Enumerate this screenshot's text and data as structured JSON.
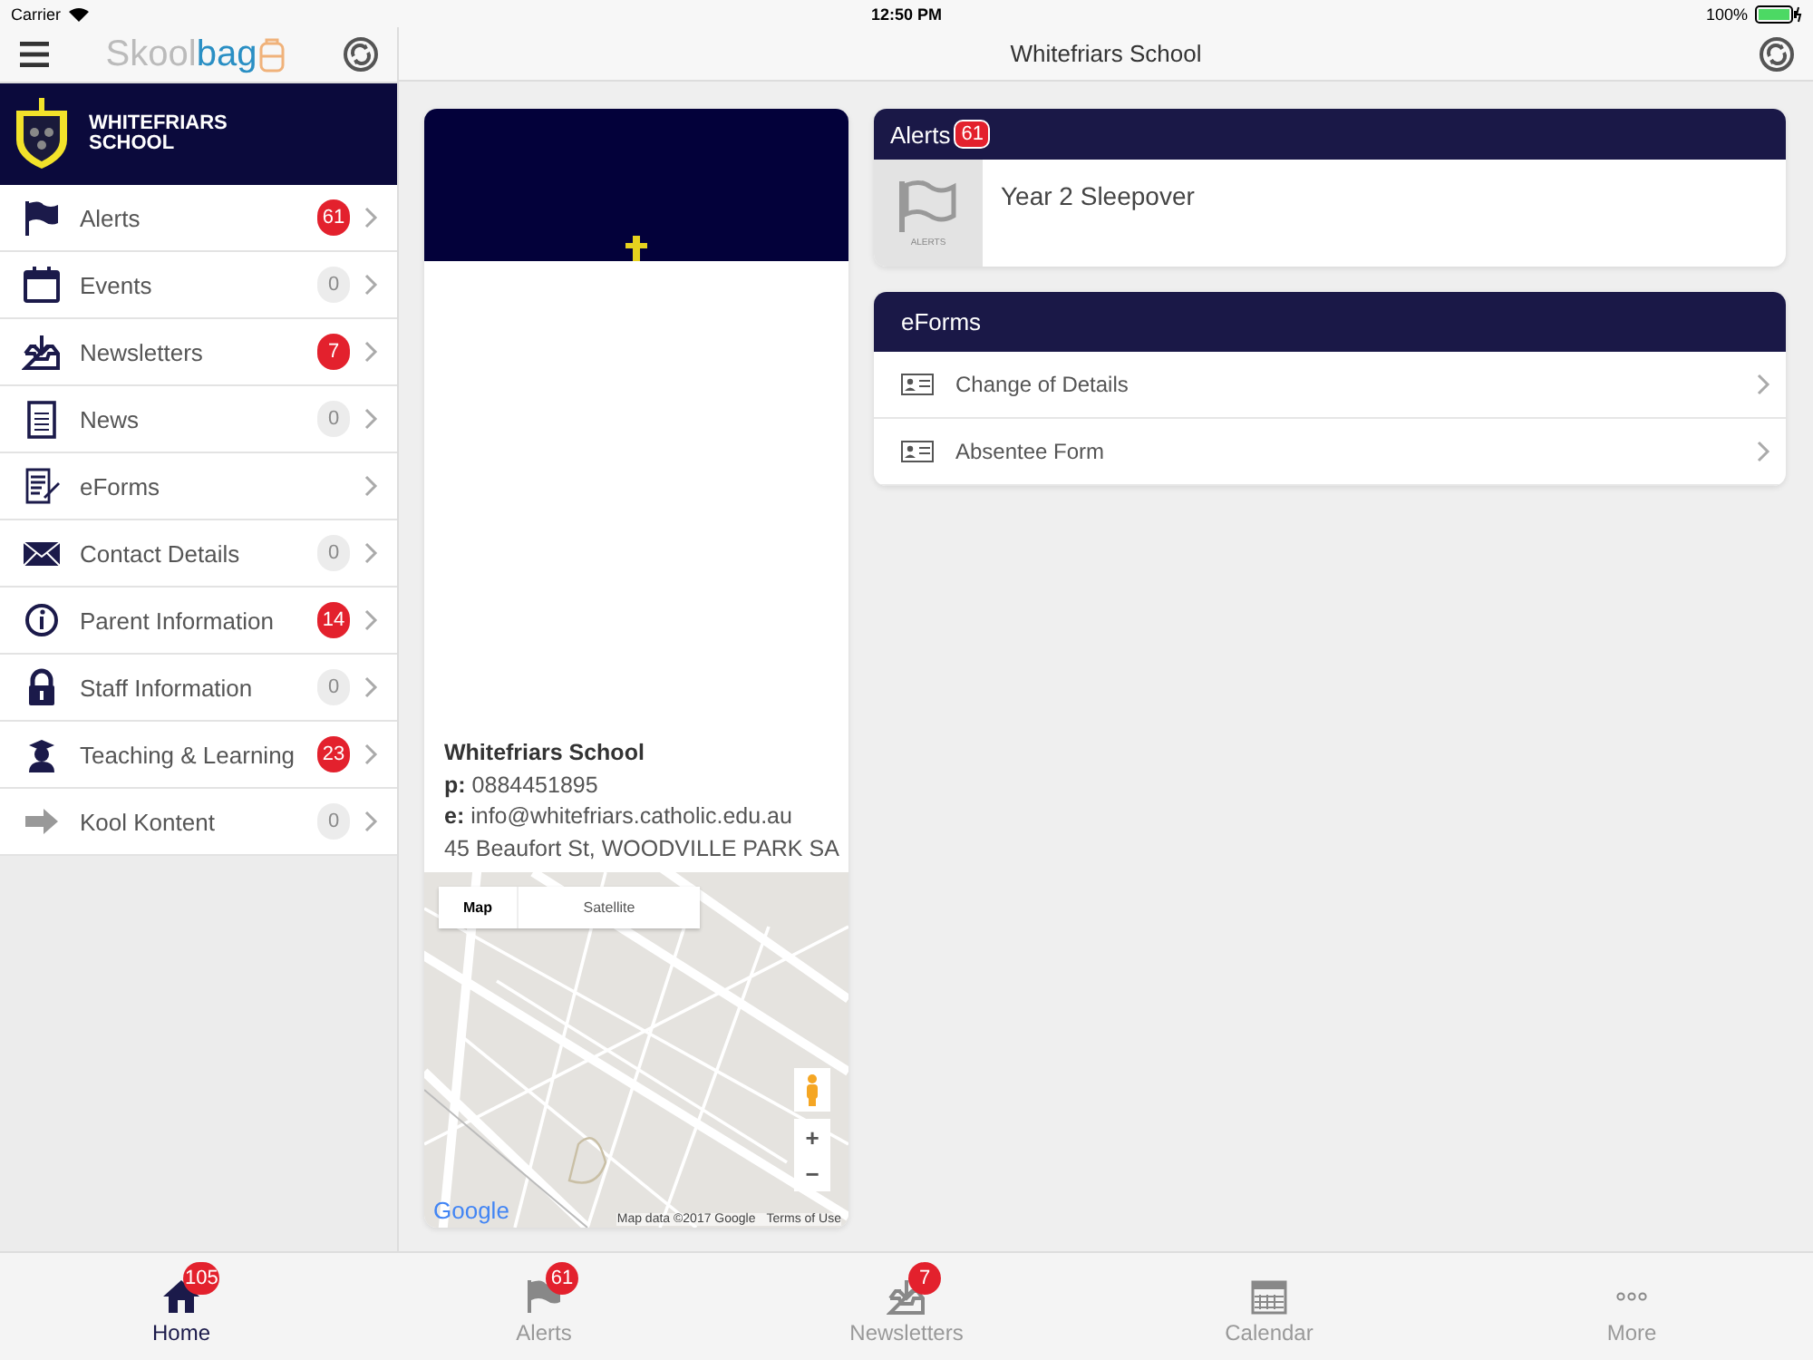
{
  "status_bar": {
    "carrier": "Carrier",
    "time": "12:50 PM",
    "battery": "100%"
  },
  "sidebar": {
    "logo": {
      "part_1": "Skool",
      "part_2": "bag"
    },
    "school_name": "WHITEFRIARS\nSCHOOL",
    "items": [
      {
        "label": "Alerts",
        "badge": "61",
        "unread": true
      },
      {
        "label": "Events",
        "badge": "0",
        "unread": false
      },
      {
        "label": "Newsletters",
        "badge": "7",
        "unread": true
      },
      {
        "label": "News",
        "badge": "0",
        "unread": false
      },
      {
        "label": "eForms"
      },
      {
        "label": "Contact Details",
        "badge": "0",
        "unread": false
      },
      {
        "label": "Parent Information",
        "badge": "14",
        "unread": true
      },
      {
        "label": "Staff Information",
        "badge": "0",
        "unread": false
      },
      {
        "label": "Teaching & Learning",
        "badge": "23",
        "unread": true
      },
      {
        "label": "Kool Kontent",
        "badge": "0",
        "unread": false
      }
    ]
  },
  "window": {
    "title": "Whitefriars School"
  },
  "school_card": {
    "name": "Whitefriars School",
    "phone": "**p:** 0884451895",
    "email": "**e:** info@whitefriars.catholic.edu.au",
    "address": "45 Beaufort St, WOODVILLE PARK SA",
    "map": {
      "kind": "picture",
      "tabs": [
        {
          "label": "Map",
          "selected": true
        },
        {
          "label": "Satellite",
          "selected": false
        }
      ],
      "zoom_in": "+",
      "zoom_out": "−",
      "logo": "Google",
      "attribution": "Map data ©2017 Google",
      "terms": "Terms of Use"
    }
  },
  "alerts_card": {
    "title": "Alerts",
    "badge": "61",
    "thumb_label": "ALERTS",
    "items": [
      {
        "title": "Year 2 Sleepover"
      }
    ]
  },
  "eforms_card": {
    "title": "eForms",
    "items": [
      {
        "label": "Change of Details"
      },
      {
        "label": "Absentee Form"
      }
    ]
  },
  "tab_bar": [
    {
      "label": "Home",
      "badge": "105",
      "selected": true
    },
    {
      "label": "Alerts",
      "badge": "61",
      "selected": false
    },
    {
      "label": "Newsletters",
      "badge": "7",
      "selected": false
    },
    {
      "label": "Calendar",
      "selected": false
    },
    {
      "label": "More",
      "selected": false
    }
  ]
}
